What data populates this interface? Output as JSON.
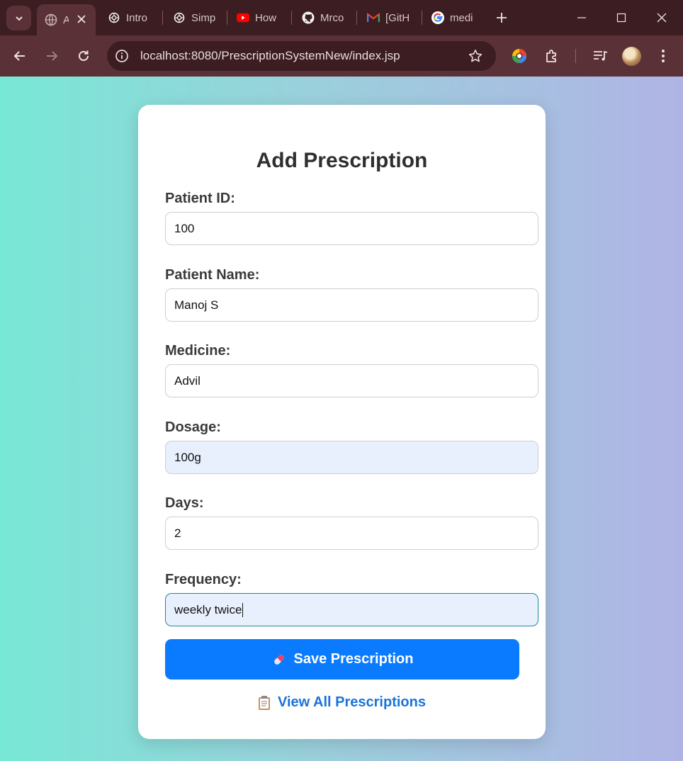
{
  "browser": {
    "tabs": [
      {
        "title": "A",
        "icon": "globe-icon",
        "active": true
      },
      {
        "title": "Intro",
        "icon": "openai-icon"
      },
      {
        "title": "Simp",
        "icon": "openai-icon"
      },
      {
        "title": "How",
        "icon": "youtube-icon"
      },
      {
        "title": "Mrco",
        "icon": "github-icon"
      },
      {
        "title": "[GitH",
        "icon": "gmail-icon"
      },
      {
        "title": "medi",
        "icon": "google-icon"
      }
    ],
    "url": "localhost:8080/PrescriptionSystemNew/index.jsp"
  },
  "form": {
    "title": "Add Prescription",
    "fields": [
      {
        "label": "Patient ID:",
        "value": "100"
      },
      {
        "label": "Patient Name:",
        "value": "Manoj S"
      },
      {
        "label": "Medicine:",
        "value": "Advil"
      },
      {
        "label": "Dosage:",
        "value": "100g"
      },
      {
        "label": "Days:",
        "value": "2"
      },
      {
        "label": "Frequency:",
        "value": "weekly twice"
      }
    ],
    "save_label": "Save Prescription",
    "save_icon": "pill-icon",
    "view_label": "View All Prescriptions",
    "view_icon": "clipboard-icon"
  },
  "colors": {
    "accent": "#0a7bff",
    "link": "#1a73d9",
    "autofill": "#e8f0fe",
    "chrome": "#5a3137"
  }
}
